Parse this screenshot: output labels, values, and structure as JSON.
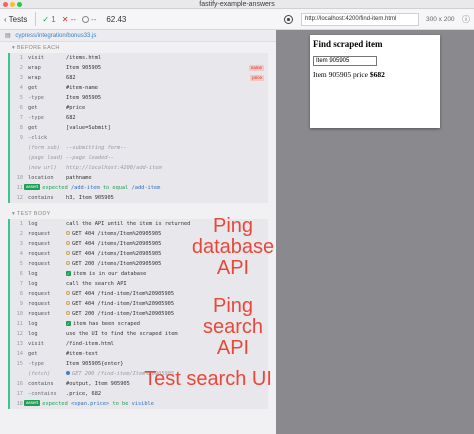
{
  "window": {
    "title": "fastify-example-answers"
  },
  "topbar": {
    "tests_label": "Tests",
    "passed": "1",
    "failed": "--",
    "pending": "--",
    "duration": "62.43"
  },
  "spec": {
    "path": "cypress/integration/bonus33.js"
  },
  "sections": {
    "before_each": "BEFORE EACH",
    "test_body": "TEST BODY"
  },
  "before_each": [
    {
      "num": "1",
      "name": "visit",
      "msg": "/items.html"
    },
    {
      "num": "2",
      "name": "wrap",
      "msg": "Item 905905",
      "badge": "name"
    },
    {
      "num": "3",
      "name": "wrap",
      "msg": "682",
      "badge": "price"
    },
    {
      "num": "4",
      "name": "get",
      "msg": "#item-name"
    },
    {
      "num": "5",
      "name": "-type",
      "msg": "Item 905905",
      "child": true
    },
    {
      "num": "6",
      "name": "get",
      "msg": "#price"
    },
    {
      "num": "7",
      "name": "-type",
      "msg": "682",
      "child": true
    },
    {
      "num": "8",
      "name": "get",
      "msg": "[value=Submit]"
    },
    {
      "num": "9",
      "name": "-click",
      "msg": "",
      "child": true
    },
    {
      "num": "",
      "name": "(form sub)",
      "msg": "--submitting form--",
      "faded": true
    },
    {
      "num": "",
      "name": "(page load)",
      "msg": "--page loaded--",
      "faded": true
    },
    {
      "num": "",
      "name": "(new url)",
      "msg": "http://localhost:4200/add-item",
      "faded": true
    },
    {
      "num": "10",
      "name": "location",
      "msg": "pathname"
    },
    {
      "num": "11",
      "name": "",
      "assert": "assert",
      "pre": "expected ",
      "hl": "/add-item",
      "mid": " to equal ",
      "hl2": "/add-item"
    },
    {
      "num": "12",
      "name": "contains",
      "msg": "h3, Item 905905"
    }
  ],
  "test_body": [
    {
      "num": "1",
      "name": "log",
      "msg": "call the API until the item is returned"
    },
    {
      "num": "2",
      "name": "request",
      "req": "pending",
      "msg": "GET 404 /items/Item%20905905"
    },
    {
      "num": "3",
      "name": "request",
      "req": "pending",
      "msg": "GET 404 /items/Item%20905905"
    },
    {
      "num": "4",
      "name": "request",
      "req": "pending",
      "msg": "GET 404 /items/Item%20905905"
    },
    {
      "num": "5",
      "name": "request",
      "req": "pending",
      "msg": "GET 200 /items/Item%20905905"
    },
    {
      "num": "6",
      "name": "log",
      "check": true,
      "msg": "item is in our database"
    },
    {
      "num": "7",
      "name": "log",
      "msg": "call the search API"
    },
    {
      "num": "8",
      "name": "request",
      "req": "pending",
      "msg": "GET 404 /find-item/Item%20905905"
    },
    {
      "num": "9",
      "name": "request",
      "req": "pending",
      "msg": "GET 404 /find-item/Item%20905905"
    },
    {
      "num": "10",
      "name": "request",
      "req": "pending",
      "msg": "GET 200 /find-item/Item%20905905"
    },
    {
      "num": "11",
      "name": "log",
      "check": true,
      "msg": "item has been scraped"
    },
    {
      "num": "12",
      "name": "log",
      "msg": "use the UI to find the scraped item"
    },
    {
      "num": "13",
      "name": "visit",
      "msg": "/find-item.html"
    },
    {
      "num": "14",
      "name": "get",
      "msg": "#item-text"
    },
    {
      "num": "15",
      "name": "-type",
      "msg": "Item 905905{enter}",
      "child": true
    },
    {
      "num": "",
      "name": "(fetch)",
      "req": "done",
      "msg": "GET 200 /find-item/Item%20905905",
      "faded": true
    },
    {
      "num": "16",
      "name": "contains",
      "msg": "#output, Item 905905"
    },
    {
      "num": "17",
      "name": "-contains",
      "msg": ".price, 682",
      "child": true
    },
    {
      "num": "18",
      "name": "",
      "assert": "assert",
      "pre": "expected ",
      "hl": "<span.price>",
      "mid": " to be ",
      "hl2": "visible"
    }
  ],
  "annotations": {
    "ping_db": "Ping database API",
    "ping_search": "Ping search API",
    "test_ui": "Test search UI"
  },
  "aut": {
    "url": "http://localhost:4200/find-item.html",
    "size": "300 x 200",
    "page_title": "Find scraped item",
    "input_value": "Item 905905",
    "result_prefix": "Item 905905 price ",
    "result_price": "$682"
  },
  "colors": {
    "pass": "#1f9d55",
    "fail": "#d0342c",
    "annotation": "#e8483a",
    "link": "#3b82c4"
  }
}
